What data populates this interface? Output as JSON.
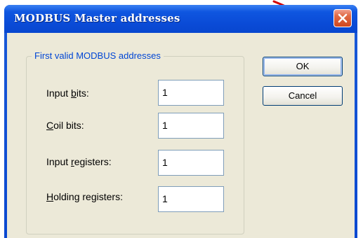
{
  "window": {
    "title": "MODBUS Master addresses"
  },
  "icons": {
    "close": "close-icon"
  },
  "group": {
    "legend": "First valid MODBUS addresses",
    "rows": [
      {
        "label_pre": "Input ",
        "label_access": "b",
        "label_post": "its:",
        "value": "1"
      },
      {
        "label_pre": "",
        "label_access": "C",
        "label_post": "oil bits:",
        "value": "1"
      },
      {
        "label_pre": "Input ",
        "label_access": "r",
        "label_post": "egisters:",
        "value": "1"
      },
      {
        "label_pre": "",
        "label_access": "H",
        "label_post": "olding registers:",
        "value": "1"
      }
    ]
  },
  "buttons": {
    "ok": "OK",
    "cancel": "Cancel"
  },
  "colors": {
    "titlebar": "#0a4ad6",
    "legend": "#0046d5",
    "close": "#d0471f",
    "dialog_bg": "#ece9d8"
  }
}
